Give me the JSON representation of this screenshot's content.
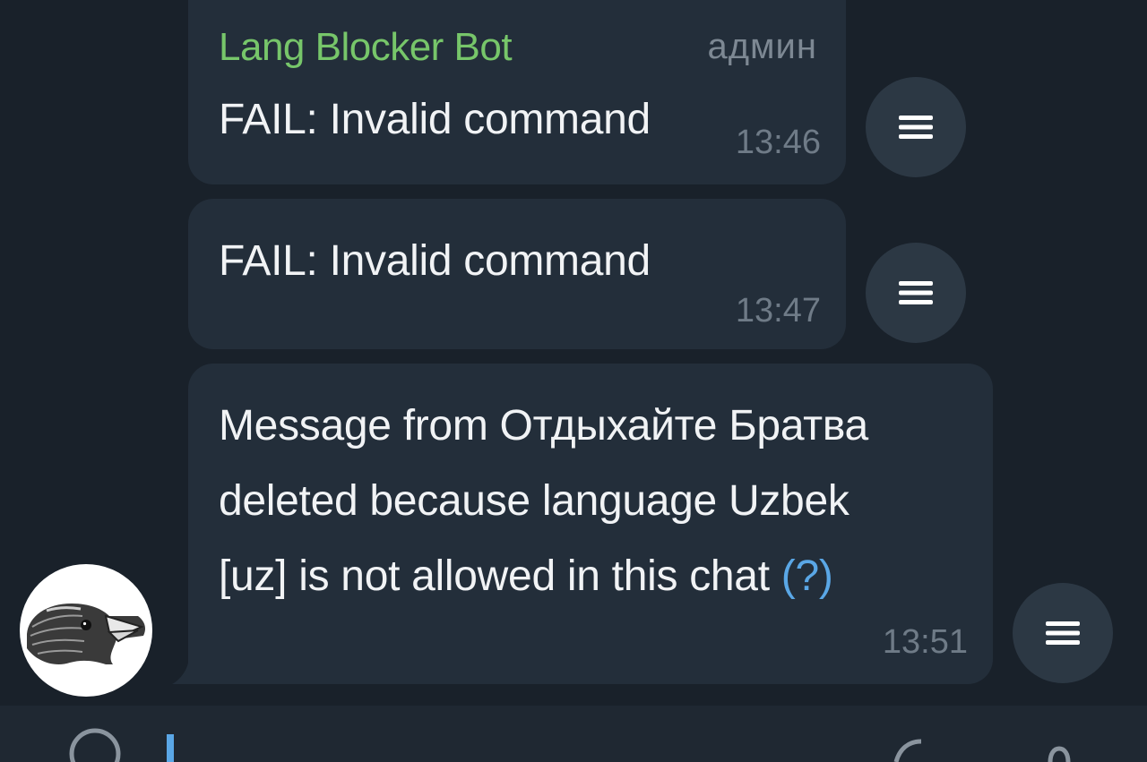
{
  "messages": [
    {
      "sender": "Lang Blocker Bot",
      "badge": "админ",
      "text": "FAIL: Invalid command",
      "time": "13:46"
    },
    {
      "text": "FAIL: Invalid command",
      "time": "13:47"
    },
    {
      "lines": [
        "Message from Отдыхайте Братва",
        "deleted because language Uzbek"
      ],
      "last_line": "[uz] is not allowed in this chat ",
      "help_link": "(?)",
      "time": "13:51"
    }
  ],
  "icons": {
    "menu": "menu-lines-icon",
    "avatar": "sparrow-bird-avatar"
  },
  "colors": {
    "background": "#19212a",
    "bubble": "#232e3a",
    "sender": "#77c66a",
    "link": "#5aa7e6",
    "time": "#6f7b87"
  }
}
